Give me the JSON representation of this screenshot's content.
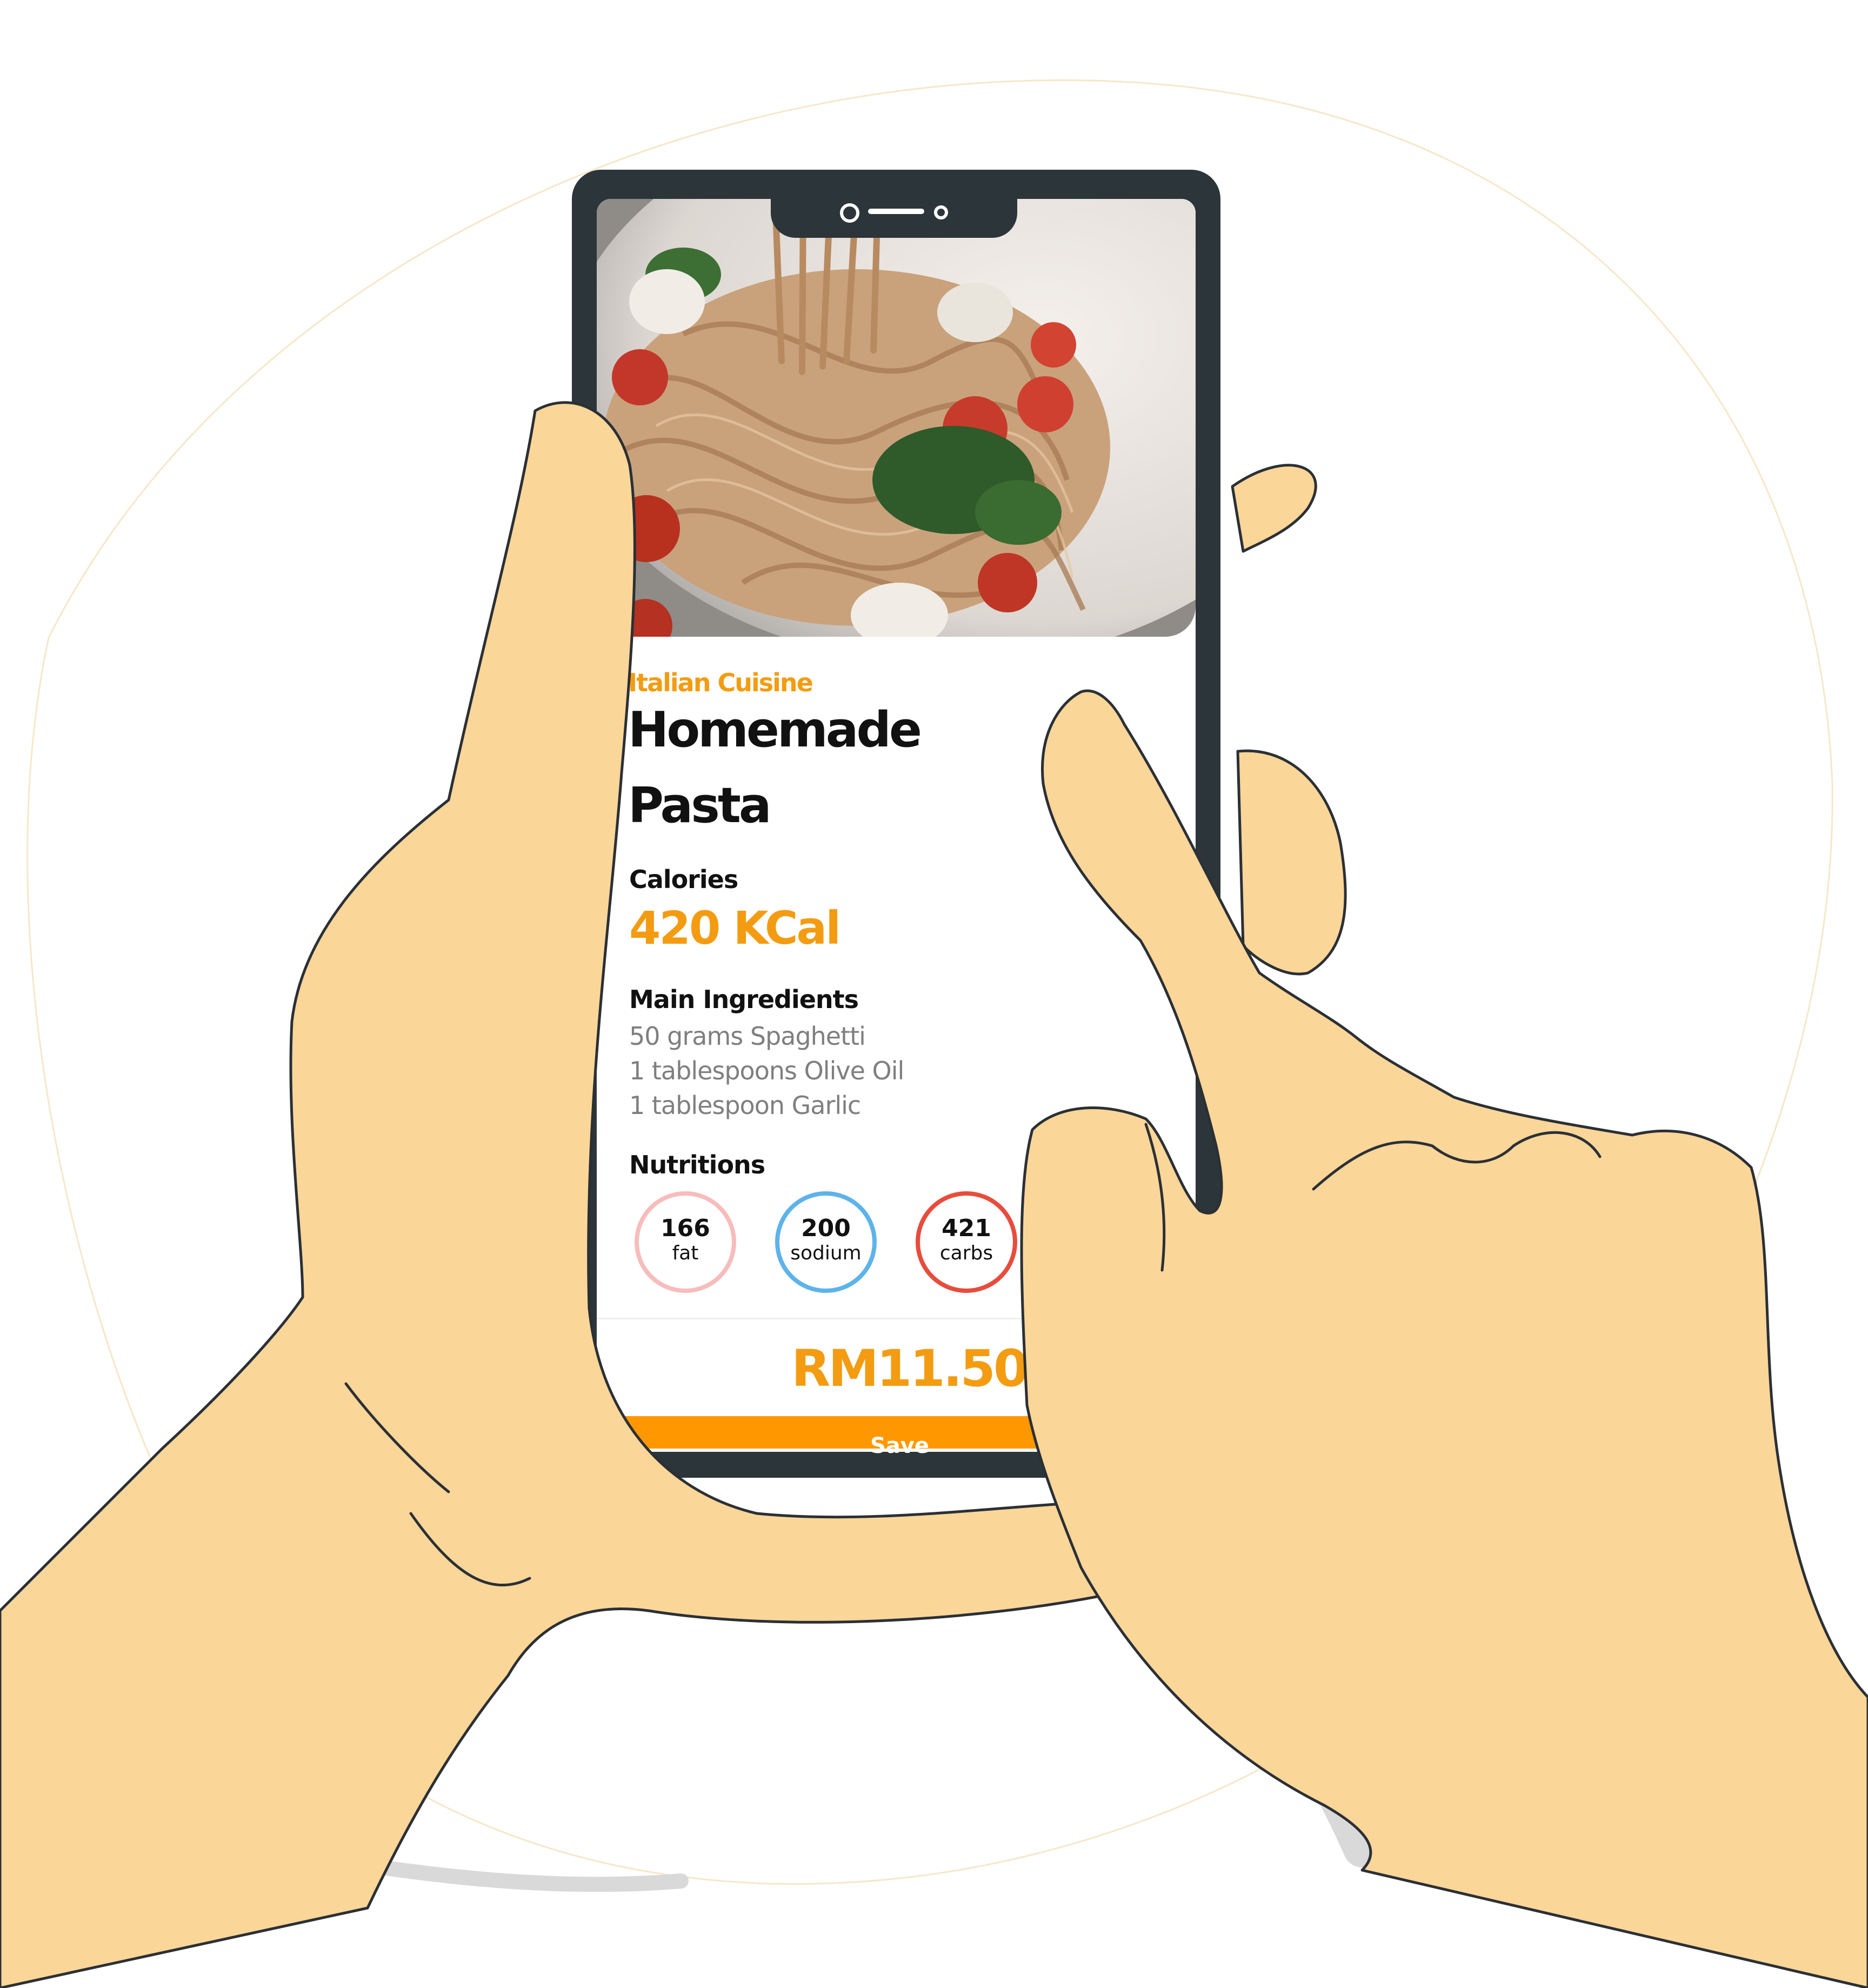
{
  "recipe": {
    "cuisine": "Italian Cuisine",
    "title_line_1": "Homemade",
    "title_line_2": "Pasta"
  },
  "calories": {
    "label": "Calories",
    "value": "420 KCal"
  },
  "ingredients": {
    "label": "Main Ingredients",
    "items": [
      "50 grams Spaghetti",
      "1 tablespoons Olive Oil",
      "1 tablespoon Garlic"
    ]
  },
  "nutritions": {
    "label": "Nutritions",
    "items": [
      {
        "value": "166",
        "unit": "fat"
      },
      {
        "value": "200",
        "unit": "sodium"
      },
      {
        "value": "421",
        "unit": "carbs"
      }
    ]
  },
  "footer": {
    "price": "RM11.50",
    "save_label": "Save"
  },
  "colors": {
    "accent": "#f39c12",
    "phone_frame": "#2c3539",
    "save_button": "#ff9800",
    "fat_ring": "#f7bcbc",
    "sodium_ring": "#5db3ea",
    "carbs_ring": "#e74c3c",
    "hand_fill": "#fad699",
    "hand_outline": "#2b3035"
  }
}
